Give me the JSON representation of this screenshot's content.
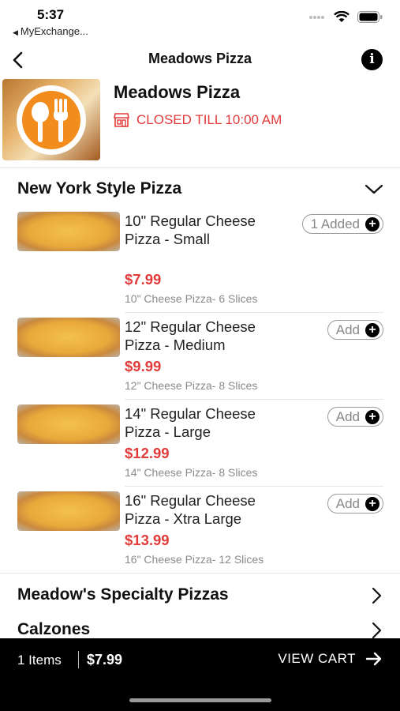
{
  "status_bar": {
    "time": "5:37",
    "back_app": "MyExchange..."
  },
  "nav": {
    "title": "Meadows Pizza"
  },
  "store": {
    "name": "Meadows Pizza",
    "status": "CLOSED TILL 10:00 AM",
    "status_color": "#e23b3b"
  },
  "category_open": {
    "title": "New York Style Pizza",
    "items": [
      {
        "name": "10\" Regular Cheese Pizza - Small",
        "price": "$7.99",
        "description": "10\" Cheese Pizza- 6 Slices",
        "button": "1 Added"
      },
      {
        "name": "12\" Regular Cheese Pizza - Medium",
        "price": "$9.99",
        "description": "12\" Cheese Pizza- 8 Slices",
        "button": "Add"
      },
      {
        "name": "14\" Regular Cheese Pizza - Large",
        "price": "$12.99",
        "description": "14\" Cheese Pizza- 8 Slices",
        "button": "Add"
      },
      {
        "name": "16\" Regular Cheese Pizza - Xtra Large",
        "price": "$13.99",
        "description": "16\" Cheese Pizza- 12 Slices",
        "button": "Add"
      }
    ]
  },
  "categories_collapsed": [
    {
      "title": "Meadow's Specialty Pizzas"
    },
    {
      "title": "Calzones"
    }
  ],
  "cart": {
    "count": "1 Items",
    "total": "$7.99",
    "view_label": "VIEW CART"
  },
  "icons": {
    "back": "chevron-left-icon",
    "info": "info-icon",
    "store": "storefront-icon",
    "expand": "chevron-down-icon",
    "collapsed": "chevron-right-icon",
    "add": "plus-icon",
    "cart": "arrow-right-icon"
  },
  "colors": {
    "accent_red": "#e23b3b",
    "logo_orange": "#f28c1c",
    "cart_bar": "#000000"
  }
}
